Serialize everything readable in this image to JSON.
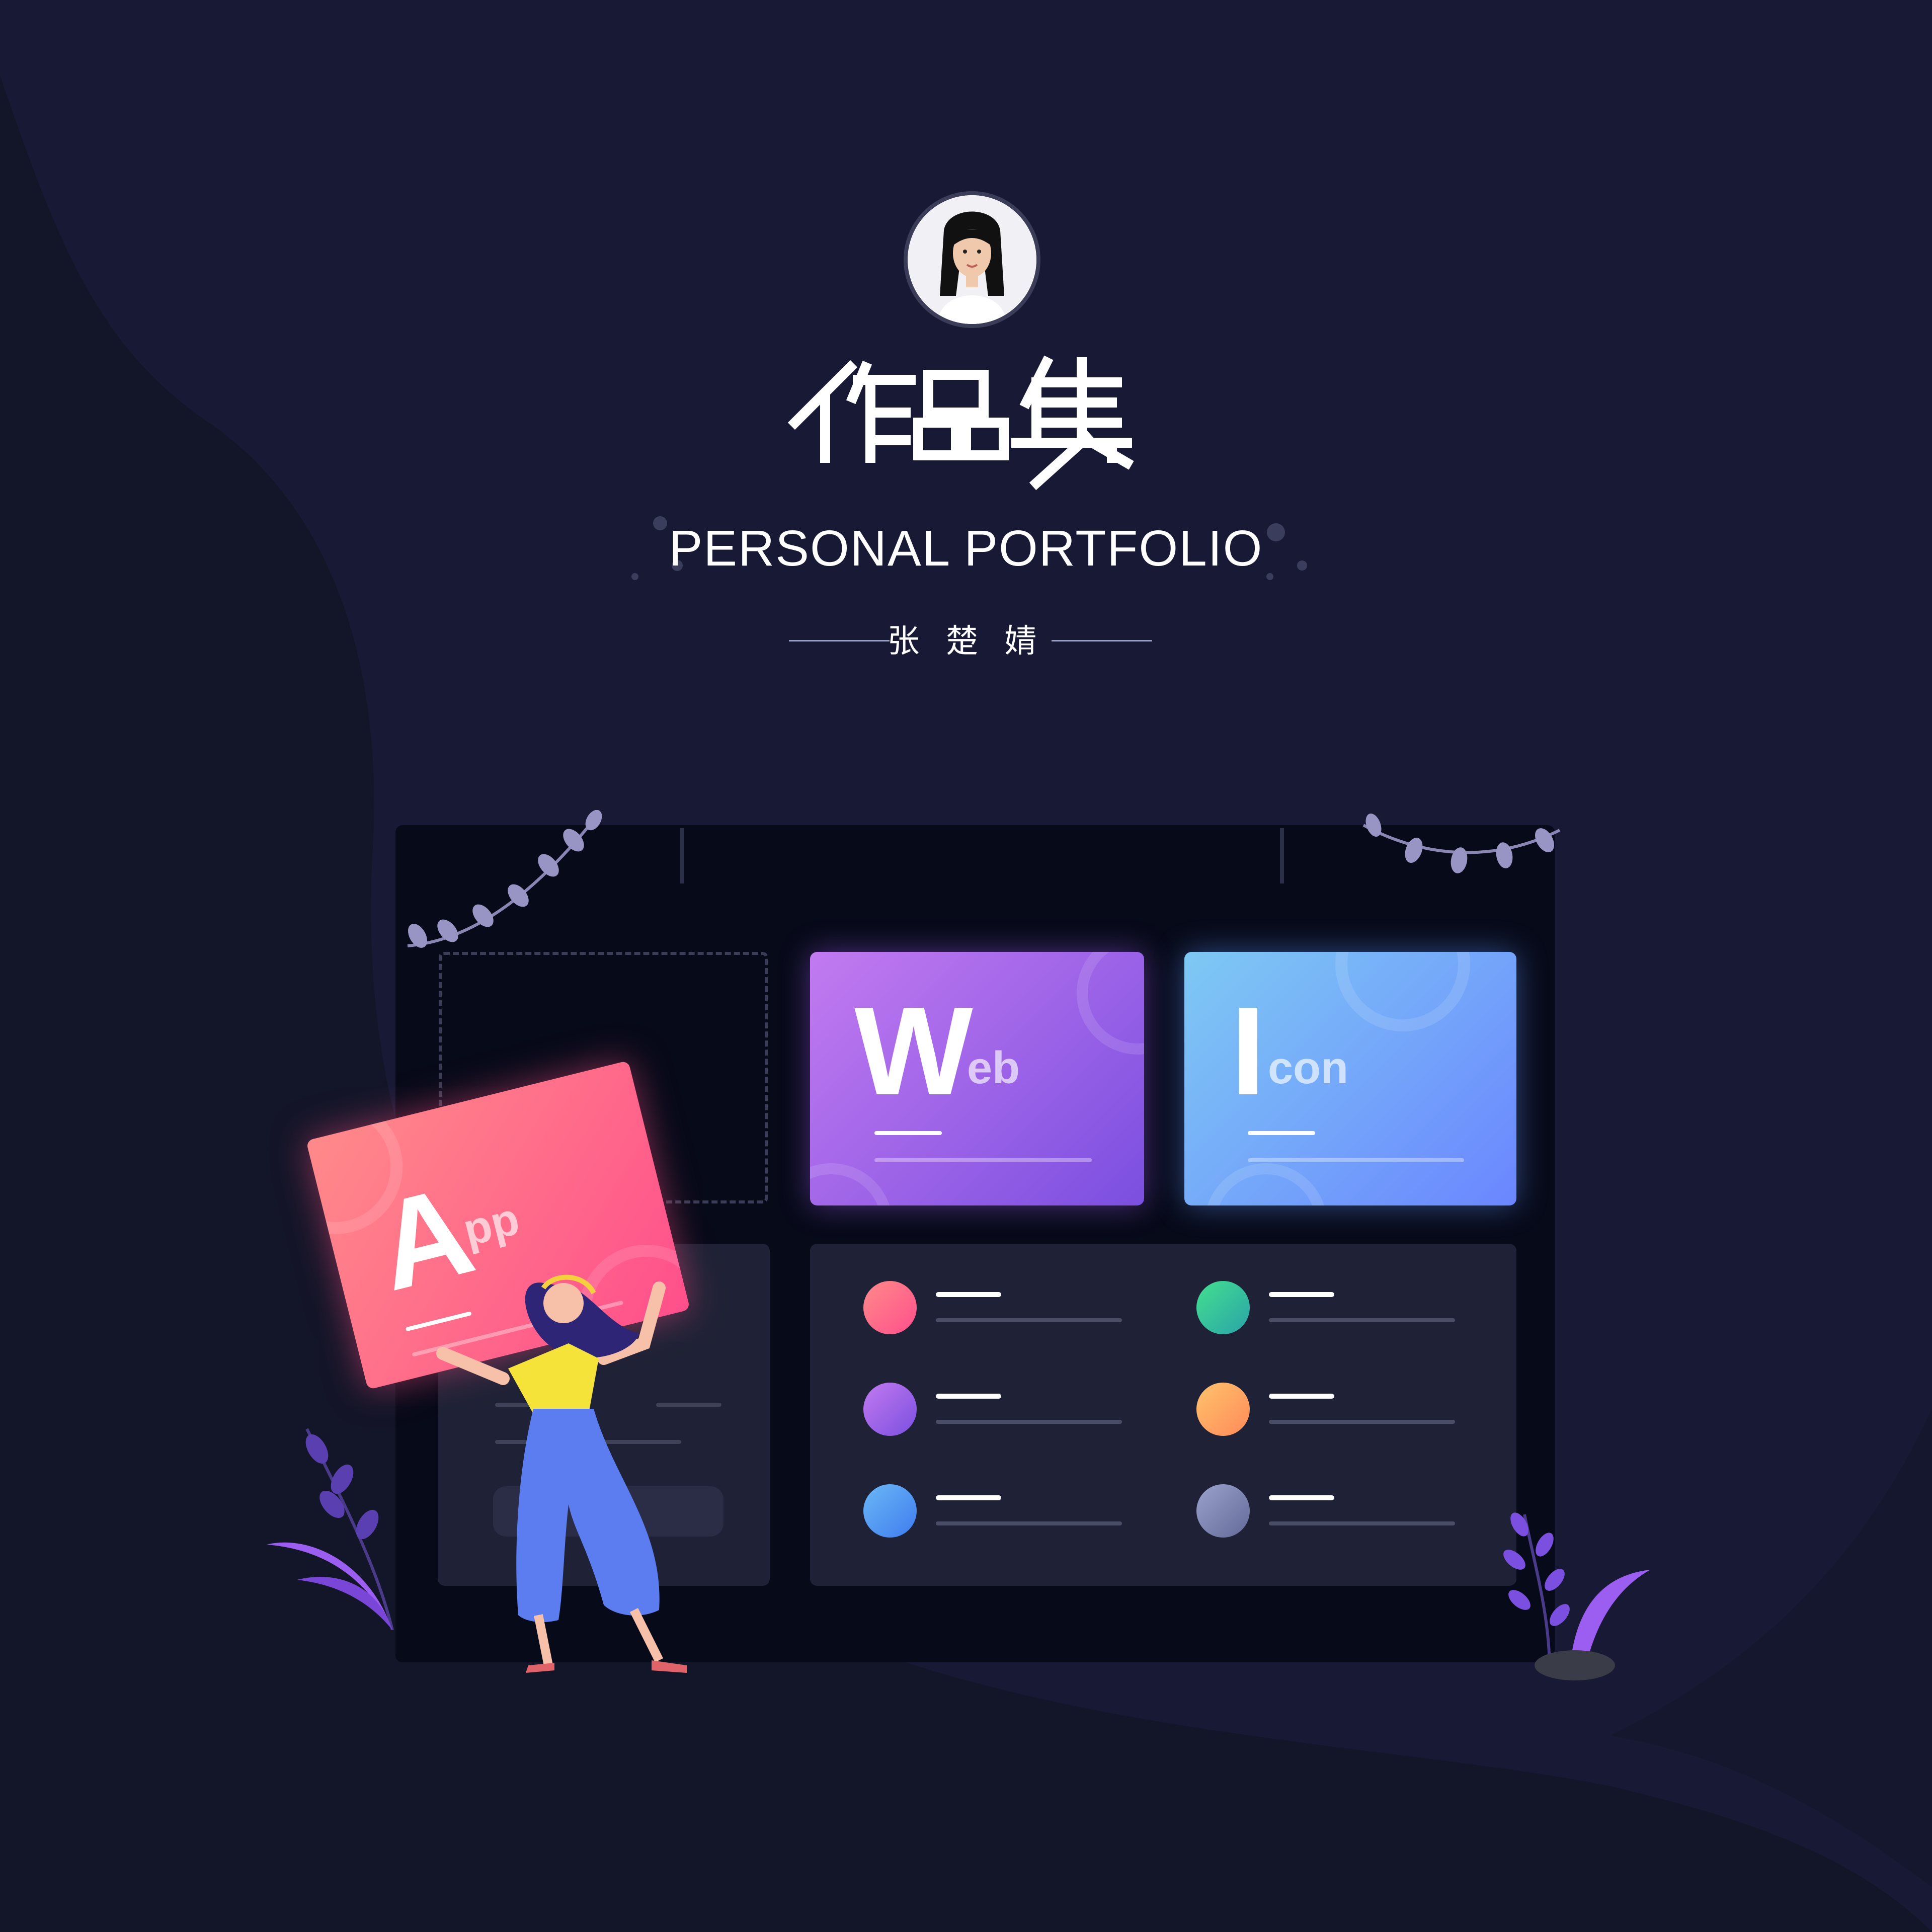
{
  "header": {
    "title": "作品集",
    "subtitle": "PERSONAL PORTFOLIO",
    "author": "张 楚 婧"
  },
  "cards": {
    "app": {
      "initial": "A",
      "rest": "pp"
    },
    "web": {
      "initial": "W",
      "rest": "eb"
    },
    "icon": {
      "initial": "I",
      "rest": "con"
    }
  },
  "colors": {
    "background": "#181a35",
    "app_gradient": [
      "#ff8a8a",
      "#ff4f8b"
    ],
    "web_gradient": [
      "#c27af0",
      "#7b4fe0"
    ],
    "icon_gradient": [
      "#7ec9f4",
      "#6b86ff"
    ],
    "list_dots": [
      "#ff5c7a",
      "#2ecf8f",
      "#9c5cf2",
      "#ff9f5a",
      "#4a8ff0",
      "#8a90b8"
    ]
  },
  "icons": [
    "avatar-photo",
    "vine-branch",
    "leaf-plant",
    "woman-illustration"
  ]
}
